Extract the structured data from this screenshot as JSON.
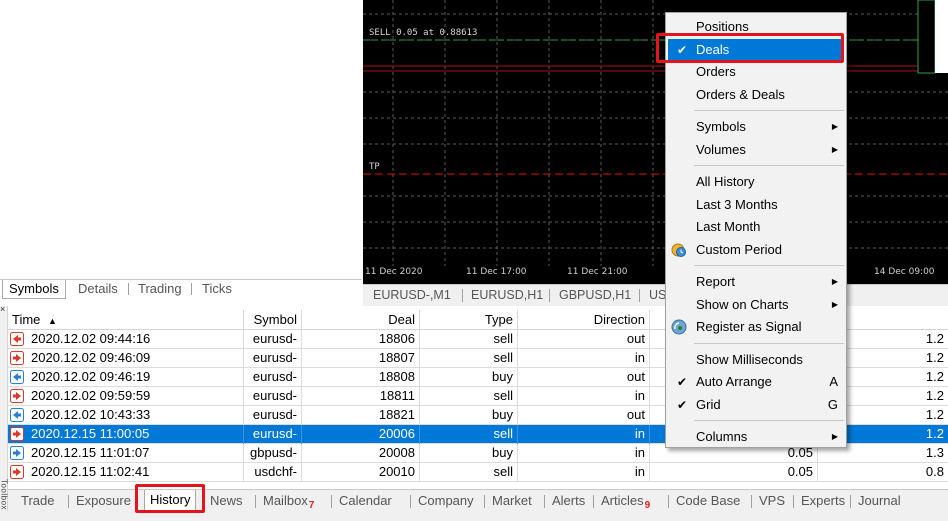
{
  "symbol_tabs": [
    "Symbols",
    "Details",
    "Trading",
    "Ticks"
  ],
  "chart": {
    "sell_label": "SELL 0.05 at 0.88613",
    "tp_label": "TP",
    "time_ticks": [
      "11 Dec 2020",
      "11 Dec 17:00",
      "11 Dec 21:00",
      "14 Dec 09:00"
    ]
  },
  "chart_tabs": [
    "EURUSD-,M1",
    "EURUSD,H1",
    "GBPUSD,H1",
    "US"
  ],
  "table": {
    "headers": [
      "Time",
      "Symbol",
      "Deal",
      "Type",
      "Direction"
    ],
    "sort_indicator": "▲",
    "rows": [
      {
        "time": "2020.12.02 09:44:16",
        "symbol": "eurusd-",
        "deal": "18806",
        "type": "sell",
        "direction": "out",
        "volume": "",
        "price": "1.2",
        "dir_icon": "out"
      },
      {
        "time": "2020.12.02 09:46:09",
        "symbol": "eurusd-",
        "deal": "18807",
        "type": "sell",
        "direction": "in",
        "volume": "",
        "price": "1.2",
        "dir_icon": "in"
      },
      {
        "time": "2020.12.02 09:46:19",
        "symbol": "eurusd-",
        "deal": "18808",
        "type": "buy",
        "direction": "out",
        "volume": "",
        "price": "1.2",
        "dir_icon": "out-buy"
      },
      {
        "time": "2020.12.02 09:59:59",
        "symbol": "eurusd-",
        "deal": "18811",
        "type": "sell",
        "direction": "in",
        "volume": "",
        "price": "1.2",
        "dir_icon": "in"
      },
      {
        "time": "2020.12.02 10:43:33",
        "symbol": "eurusd-",
        "deal": "18821",
        "type": "buy",
        "direction": "out",
        "volume": "",
        "price": "1.2",
        "dir_icon": "out-buy"
      },
      {
        "time": "2020.12.15 11:00:05",
        "symbol": "eurusd-",
        "deal": "20006",
        "type": "sell",
        "direction": "in",
        "volume": "",
        "price": "1.2",
        "dir_icon": "in",
        "selected": true
      },
      {
        "time": "2020.12.15 11:01:07",
        "symbol": "gbpusd-",
        "deal": "20008",
        "type": "buy",
        "direction": "in",
        "volume": "0.05",
        "price": "1.3",
        "dir_icon": "in-buy"
      },
      {
        "time": "2020.12.15 11:02:41",
        "symbol": "usdchf-",
        "deal": "20010",
        "type": "sell",
        "direction": "in",
        "volume": "0.05",
        "price": "0.8",
        "dir_icon": "in"
      }
    ]
  },
  "toolbox_label": "Toolbox",
  "bottom_tabs": [
    {
      "label": "Trade"
    },
    {
      "label": "Exposure"
    },
    {
      "label": "History",
      "active": true
    },
    {
      "label": "News"
    },
    {
      "label": "Mailbox",
      "badge": "7"
    },
    {
      "label": "Calendar"
    },
    {
      "label": "Company"
    },
    {
      "label": "Market"
    },
    {
      "label": "Alerts"
    },
    {
      "label": "Articles",
      "badge": "9"
    },
    {
      "label": "Code Base"
    },
    {
      "label": "VPS"
    },
    {
      "label": "Experts"
    },
    {
      "label": "Journal"
    }
  ],
  "context_menu": {
    "items": [
      {
        "label": "Positions"
      },
      {
        "label": "Deals",
        "checked": true,
        "highlighted": true
      },
      {
        "label": "Orders"
      },
      {
        "label": "Orders & Deals"
      },
      {
        "sep": true
      },
      {
        "label": "Symbols",
        "submenu": true
      },
      {
        "label": "Volumes",
        "submenu": true
      },
      {
        "sep": true
      },
      {
        "label": "All History"
      },
      {
        "label": "Last 3 Months"
      },
      {
        "label": "Last Month"
      },
      {
        "label": "Custom Period",
        "icon": "custom-period-icon"
      },
      {
        "sep": true
      },
      {
        "label": "Report",
        "submenu": true
      },
      {
        "label": "Show on Charts",
        "submenu": true
      },
      {
        "label": "Register as Signal",
        "icon": "signal-icon"
      },
      {
        "sep": true
      },
      {
        "label": "Show Milliseconds"
      },
      {
        "label": "Auto Arrange",
        "checked": true,
        "accel": "A"
      },
      {
        "label": "Grid",
        "checked": true,
        "accel": "G"
      },
      {
        "sep": true
      },
      {
        "label": "Columns",
        "submenu": true
      }
    ]
  },
  "colors": {
    "selection": "#0078d7",
    "highlight_box": "#e3141b",
    "chart_bg": "#000000",
    "sell_line": "#2ea043",
    "tp_line": "#e01010"
  }
}
